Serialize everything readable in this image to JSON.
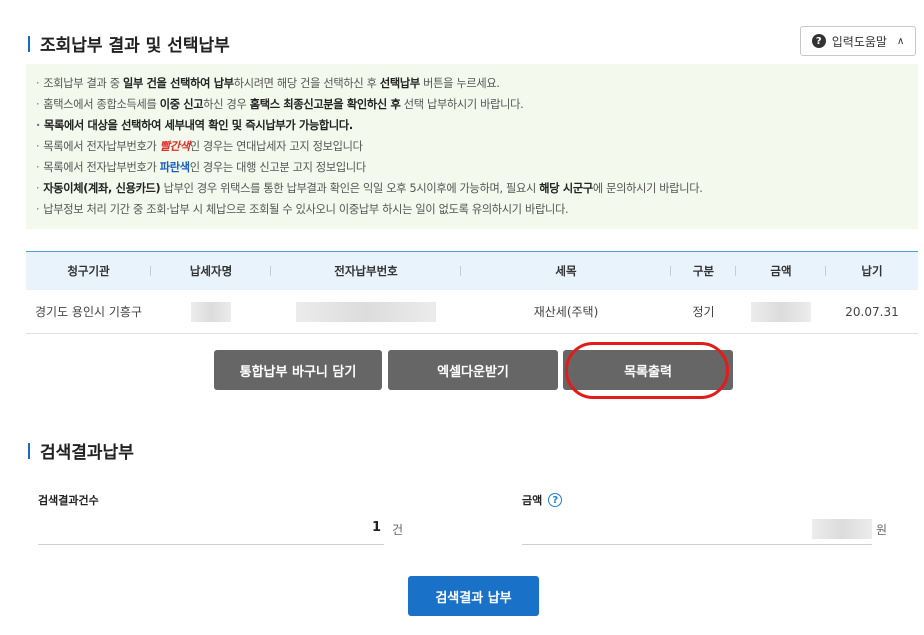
{
  "section1": {
    "title": "조회납부 결과 및 선택납부"
  },
  "help": {
    "label": "입력도움말",
    "q": "?",
    "chevron": "∧"
  },
  "notice": {
    "l1": {
      "a": "조회납부 결과 중 ",
      "b": "일부 건을 선택하여 납부",
      "c": "하시려면 해당 건을 선택하신 후 ",
      "d": "선택납부",
      "e": " 버튼을 누르세요."
    },
    "l2": {
      "a": "홈택스에서 종합소득세를 ",
      "b": "이중 신고",
      "c": "하신 경우 ",
      "d": "홈택스 최종신고분을 확인하신 후",
      "e": " 선택 납부하시기 바랍니다."
    },
    "l3": "목록에서 대상을 선택하여 세부내역 확인 및 즉시납부가 가능합니다.",
    "l4": {
      "a": "목록에서 전자납부번호가 ",
      "b": "빨간색",
      "c": "인 경우는 연대납세자 고지 정보입니다"
    },
    "l5": {
      "a": "목록에서 전자납부번호가 ",
      "b": "파란색",
      "c": "인 경우는 대행 신고분 고지 정보입니다"
    },
    "l6": {
      "a": "자동이체(계좌, 신용카드)",
      "b": " 납부인 경우 위택스를 통한 납부결과 확인은 익일 오후 5시이후에 가능하며, 필요시 ",
      "c": "해당 시군구",
      "d": "에 문의하시기 바랍니다."
    },
    "l7": "납부정보 처리 기간 중 조회·납부 시 체납으로 조회될 수 있사오니 이중납부 하시는 일이 없도록 유의하시기 바랍니다."
  },
  "table": {
    "headers": [
      "청구기관",
      "납세자명",
      "전자납부번호",
      "세목",
      "구분",
      "금액",
      "납기"
    ],
    "row": {
      "agency": "경기도 용인시 기흥구",
      "tax": "재산세(주택)",
      "type": "정기",
      "due": "20.07.31"
    }
  },
  "buttons": {
    "basket": "통합납부 바구니 담기",
    "excel": "엑셀다운받기",
    "print": "목록출력"
  },
  "section2": {
    "title": "검색결과납부"
  },
  "result": {
    "count_label": "검색결과건수",
    "count_value": "1",
    "count_unit": "건",
    "amount_label": "금액",
    "amount_unit": "원",
    "pay_button": "검색결과 납부"
  },
  "colors": {
    "accent_blue": "#1a72c8",
    "highlight_red": "#e21b1b",
    "notice_bg": "#f3f9ec"
  }
}
